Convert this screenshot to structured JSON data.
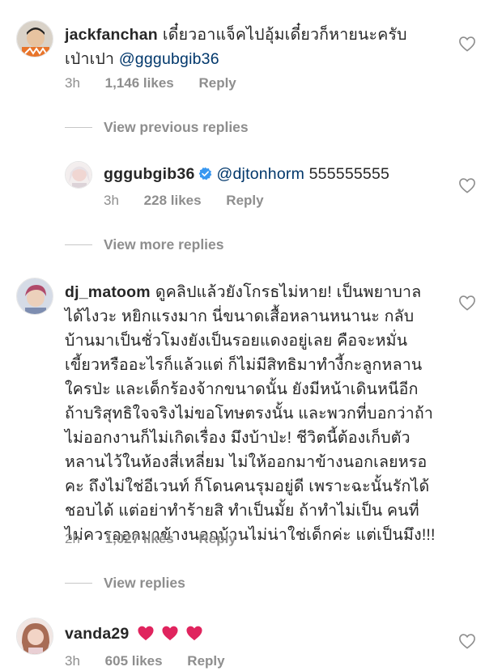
{
  "comments": [
    {
      "username": "jackfanchan",
      "text_line1": "เดี๋ยวอาแจ็คไปอุ้มเดี๋ยวก็หายนะครับ",
      "text_line2_plain": "เป่าเปา ",
      "mention": "@gggubgib36",
      "time": "3h",
      "likes": "1,146 likes",
      "reply_label": "Reply"
    },
    {
      "username": "gggubgib36",
      "verified": true,
      "mention": "@djtonhorm",
      "text": "555555555",
      "time": "3h",
      "likes": "228 likes",
      "reply_label": "Reply"
    },
    {
      "username": "dj_matoom",
      "lines": [
        "ดูคลิปแล้วยังโกรธไม่หาย! เป็นพยาบาล",
        "ได้ไงวะ หยิกแรงมาก นี่ขนาดเสื้อหลานหนานะ กลับ",
        "บ้านมาเป็นชั่วโมงยังเป็นรอยแดงอยู่เลย คือจะหมั่น",
        "เขี้ยวหรืออะไรก็แล้วแต่ ก็ไม่มีสิทธิมาทำงี้กะลูกหลาน",
        "ใครป่ะ และเด็กร้องจ้ากขนาดนั้น ยังมีหน้าเดินหนีอีก",
        "ถ้าบริสุทธิใจจริงไม่ขอโทษตรงนั้น และพวกที่บอกว่าถ้า",
        "ไม่ออกงานก็ไม่เกิดเรื่อง มึงบ้าป่ะ! ชีวิตนี้ต้องเก็บตัว",
        "หลานไว้ในห้องสี่เหลี่ยม ไม่ให้ออกมาข้างนอกเลยหรอ",
        "คะ ถึงไม่ใช่อีเวนท์ ก็โดนคนรุมอยู่ดี เพราะฉะนั้นรักได้",
        "ชอบได้ แต่อย่าทำร้ายสิ ทำเป็นมั้ย ถ้าทำไม่เป็น คนที่",
        "ไม่ควรออกมาข้างนอกบ้านไม่น่าใช่เด็กค่ะ แต่เป็นมึง!!!"
      ],
      "time": "2h",
      "likes": "1,027 likes",
      "reply_label": "Reply"
    },
    {
      "username": "vanda29",
      "time": "3h",
      "likes": "605 likes",
      "reply_label": "Reply"
    }
  ],
  "view_links": {
    "previous": "View previous replies",
    "more": "View more replies",
    "replies": "View replies"
  },
  "colors": {
    "text": "#262626",
    "meta": "#8e8e8e",
    "mention": "#00376b",
    "verified": "#3897f0",
    "red_heart": "#e0245e"
  },
  "icons": [
    "heart-outline-icon",
    "verified-badge-icon",
    "red-heart-emoji-icon"
  ]
}
